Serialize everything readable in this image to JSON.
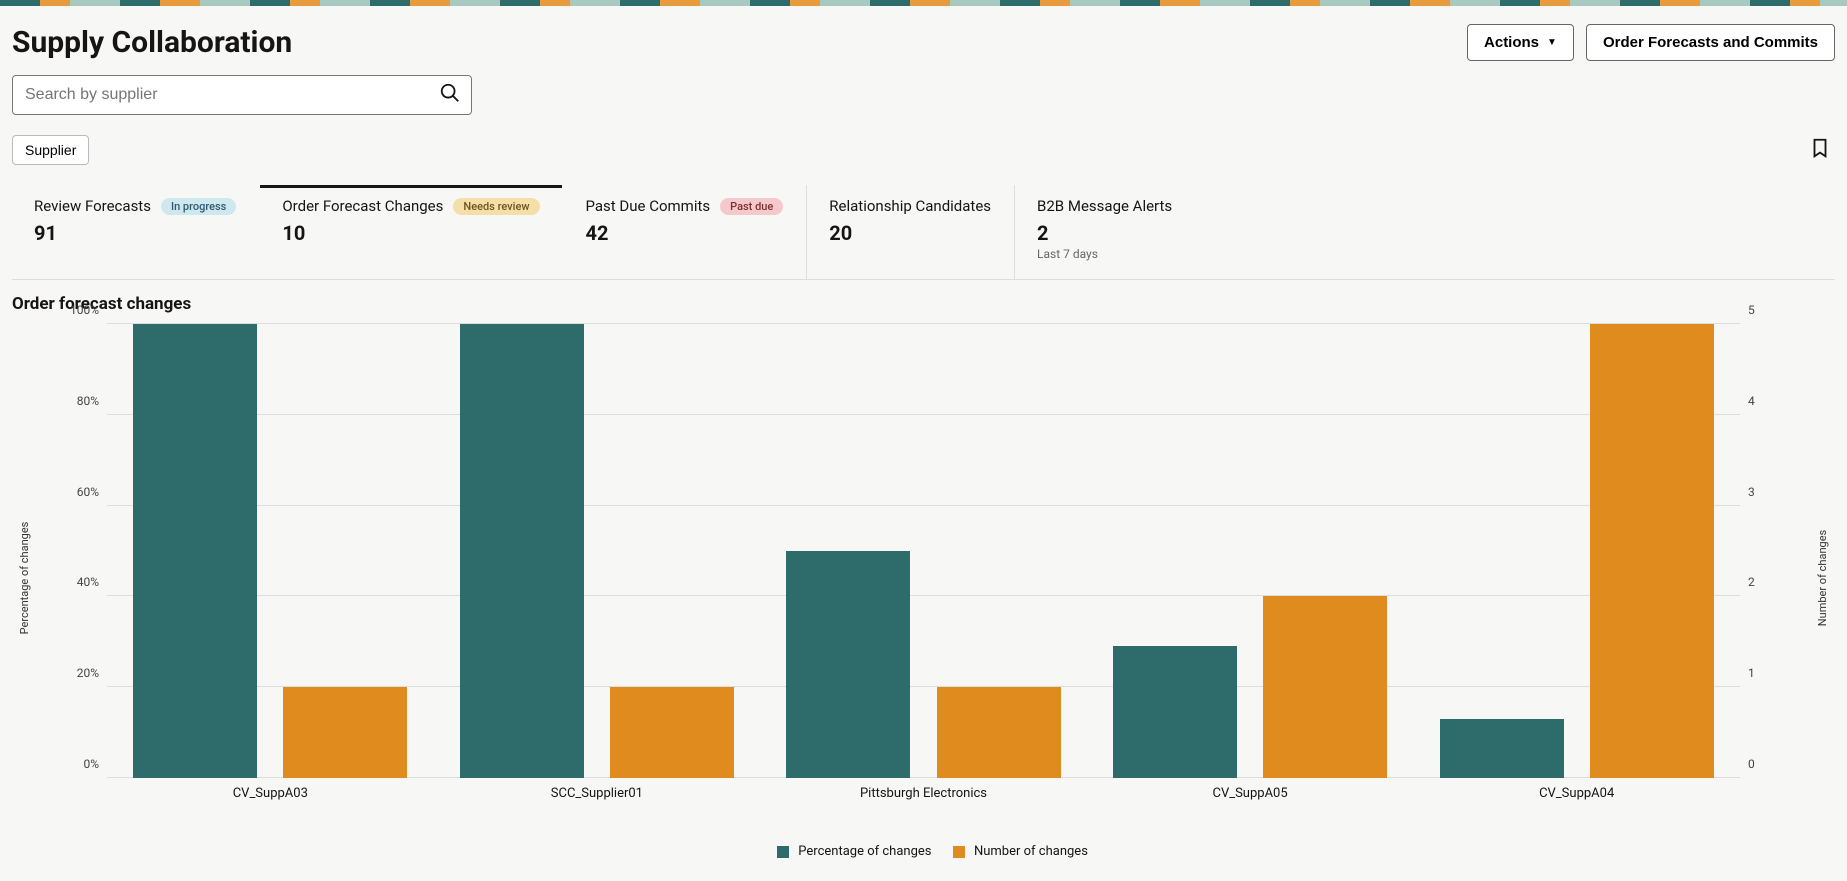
{
  "header": {
    "title": "Supply Collaboration",
    "actions_label": "Actions",
    "order_forecasts_label": "Order Forecasts and Commits"
  },
  "search": {
    "placeholder": "Search by supplier"
  },
  "filter_chip": "Supplier",
  "metrics": [
    {
      "label": "Review Forecasts",
      "value": "91",
      "badge": "In progress",
      "badge_color": "blue"
    },
    {
      "label": "Order Forecast Changes",
      "value": "10",
      "badge": "Needs review",
      "badge_color": "orange",
      "active": true
    },
    {
      "label": "Past Due Commits",
      "value": "42",
      "badge": "Past due",
      "badge_color": "red"
    },
    {
      "label": "Relationship Candidates",
      "value": "20"
    },
    {
      "label": "B2B Message Alerts",
      "value": "2",
      "sub": "Last 7 days"
    }
  ],
  "section_title": "Order forecast changes",
  "chart_data": {
    "type": "bar",
    "categories": [
      "CV_SuppA03",
      "SCC_Supplier01",
      "Pittsburgh Electronics",
      "CV_SuppA05",
      "CV_SuppA04"
    ],
    "series": [
      {
        "name": "Percentage of changes",
        "axis": "left",
        "values": [
          100,
          100,
          50,
          29,
          13
        ]
      },
      {
        "name": "Number of changes",
        "axis": "right",
        "values": [
          1,
          1,
          1,
          2,
          5
        ]
      }
    ],
    "ylabel_left": "Percentage of changes",
    "ylabel_right": "Number of changes",
    "yleft": {
      "min": 0,
      "max": 100,
      "ticks": [
        "0%",
        "20%",
        "40%",
        "60%",
        "80%",
        "100%"
      ]
    },
    "yright": {
      "min": 0,
      "max": 5,
      "ticks": [
        "0",
        "1",
        "2",
        "3",
        "4",
        "5"
      ]
    },
    "colors": {
      "Percentage of changes": "#2e6b6b",
      "Number of changes": "#e08b1e"
    }
  }
}
